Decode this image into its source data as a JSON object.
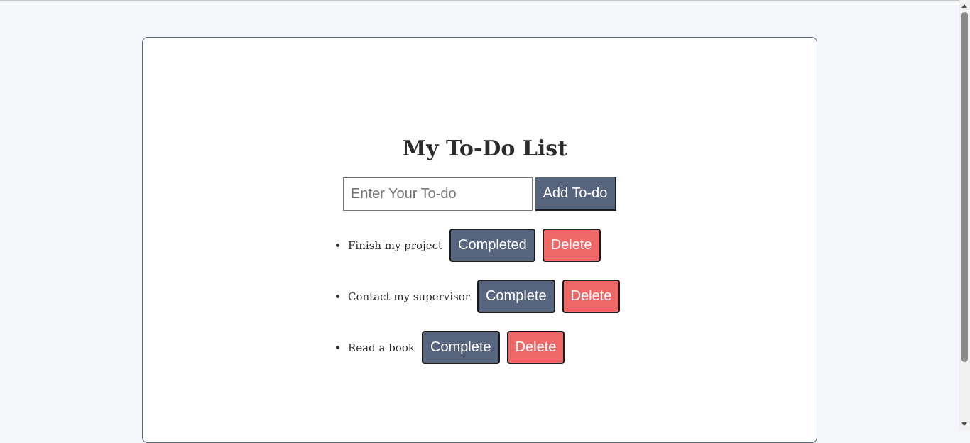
{
  "header": {
    "title": "My To-Do List"
  },
  "input": {
    "placeholder": "Enter Your To-do",
    "value": ""
  },
  "add_button": {
    "label": "Add To-do"
  },
  "todos": [
    {
      "text": "Finish my project",
      "completed": true,
      "complete_label": "Completed",
      "delete_label": "Delete"
    },
    {
      "text": "Contact my supervisor",
      "completed": false,
      "complete_label": "Complete",
      "delete_label": "Delete"
    },
    {
      "text": "Read a book",
      "completed": false,
      "complete_label": "Complete",
      "delete_label": "Delete"
    }
  ],
  "icons": {
    "scroll_up": "scroll-up-arrow-icon",
    "scroll_down": "scroll-down-arrow-icon"
  },
  "colors": {
    "primary": "#56647e",
    "danger": "#ef6868",
    "background": "#f5f6fa",
    "card": "#ffffff",
    "text": "#2d2d2d"
  }
}
